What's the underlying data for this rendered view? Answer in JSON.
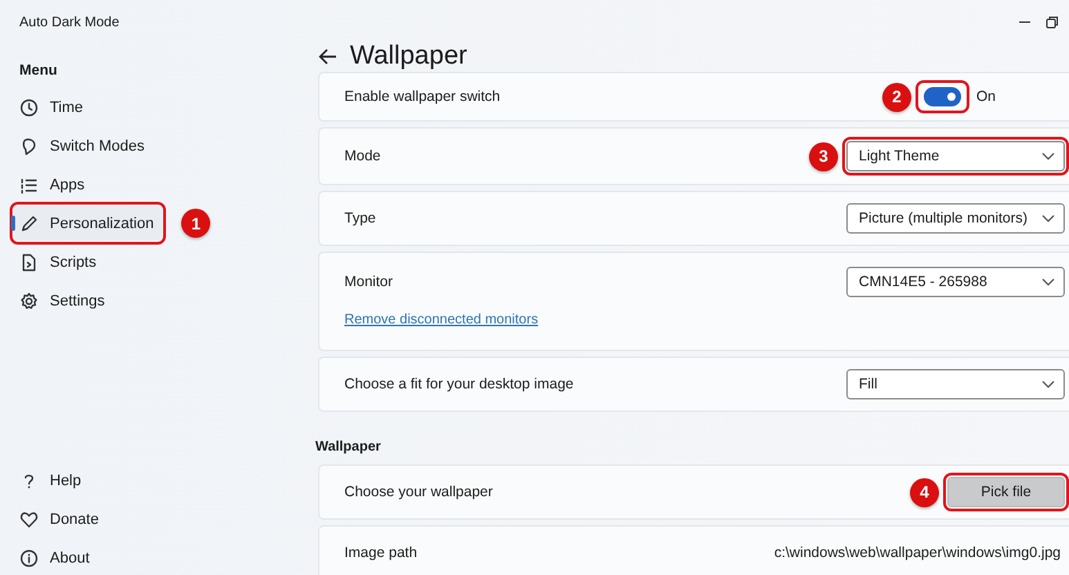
{
  "window": {
    "title": "Auto Dark Mode"
  },
  "sidebar": {
    "heading": "Menu",
    "items": [
      {
        "label": "Time",
        "selected": false
      },
      {
        "label": "Switch Modes",
        "selected": false
      },
      {
        "label": "Apps",
        "selected": false
      },
      {
        "label": "Personalization",
        "selected": true,
        "callout": "1"
      },
      {
        "label": "Scripts",
        "selected": false
      },
      {
        "label": "Settings",
        "selected": false
      }
    ],
    "footer_items": [
      {
        "label": "Help"
      },
      {
        "label": "Donate"
      },
      {
        "label": "About"
      }
    ]
  },
  "page": {
    "title": "Wallpaper"
  },
  "settings": [
    {
      "kind": "toggle",
      "label": "Enable wallpaper switch",
      "on": true,
      "state_text": "On",
      "callout": "2"
    },
    {
      "kind": "dropdown",
      "label": "Mode",
      "value": "Light Theme",
      "callout": "3"
    },
    {
      "kind": "dropdown",
      "label": "Type",
      "value": "Picture (multiple monitors)"
    },
    {
      "kind": "dropdown",
      "label": "Monitor",
      "value": "CMN14E5 - 265988",
      "link": "Remove disconnected monitors"
    },
    {
      "kind": "dropdown",
      "label": "Choose a fit for your desktop image",
      "value": "Fill"
    }
  ],
  "wallpaper_section": {
    "heading": "Wallpaper",
    "rows": [
      {
        "kind": "button",
        "label": "Choose your wallpaper",
        "button": "Pick file",
        "callout": "4"
      },
      {
        "kind": "text",
        "label": "Image path",
        "value": "c:\\windows\\web\\wallpaper\\windows\\img0.jpg"
      }
    ]
  }
}
